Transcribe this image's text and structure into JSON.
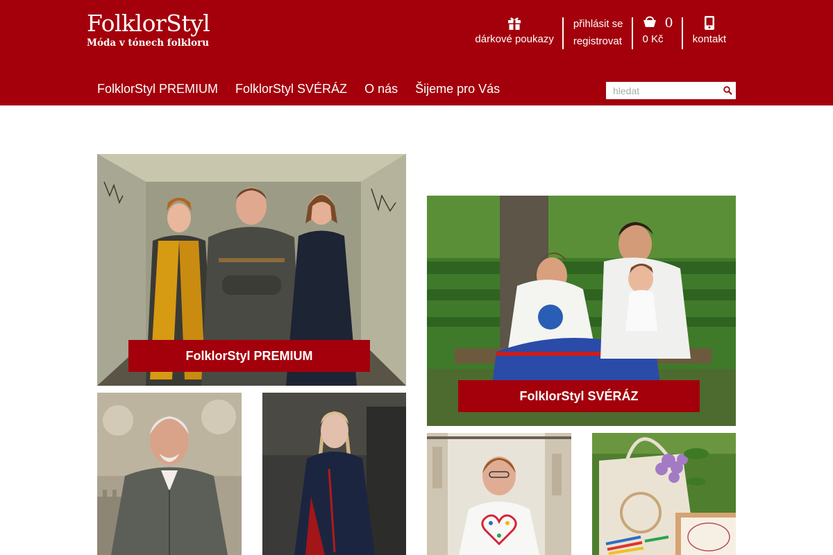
{
  "brand": {
    "name": "FolklorStyl",
    "tagline": "Móda v tónech folkloru"
  },
  "top_links": {
    "gift": {
      "label": "dárkové poukazy",
      "icon": "gift-icon"
    },
    "login": {
      "login_label": "přihlásit se",
      "register_label": "registrovat"
    },
    "cart": {
      "count": "0",
      "total": "0 Kč",
      "icon": "shopping-basket-icon"
    },
    "contact": {
      "label": "kontakt",
      "icon": "phone-icon"
    }
  },
  "nav": [
    "FolklorStyl PREMIUM",
    "FolklorStyl SVÉRÁZ",
    "O nás",
    "Šijeme pro Vás"
  ],
  "search": {
    "placeholder": "hledat",
    "icon": "search-icon"
  },
  "tiles": {
    "premium": {
      "caption": "FolklorStyl PREMIUM"
    },
    "sveraz": {
      "caption": "FolklorStyl SVÉRÁZ"
    }
  },
  "colors": {
    "brand_red": "#a3000b",
    "white": "#ffffff"
  }
}
